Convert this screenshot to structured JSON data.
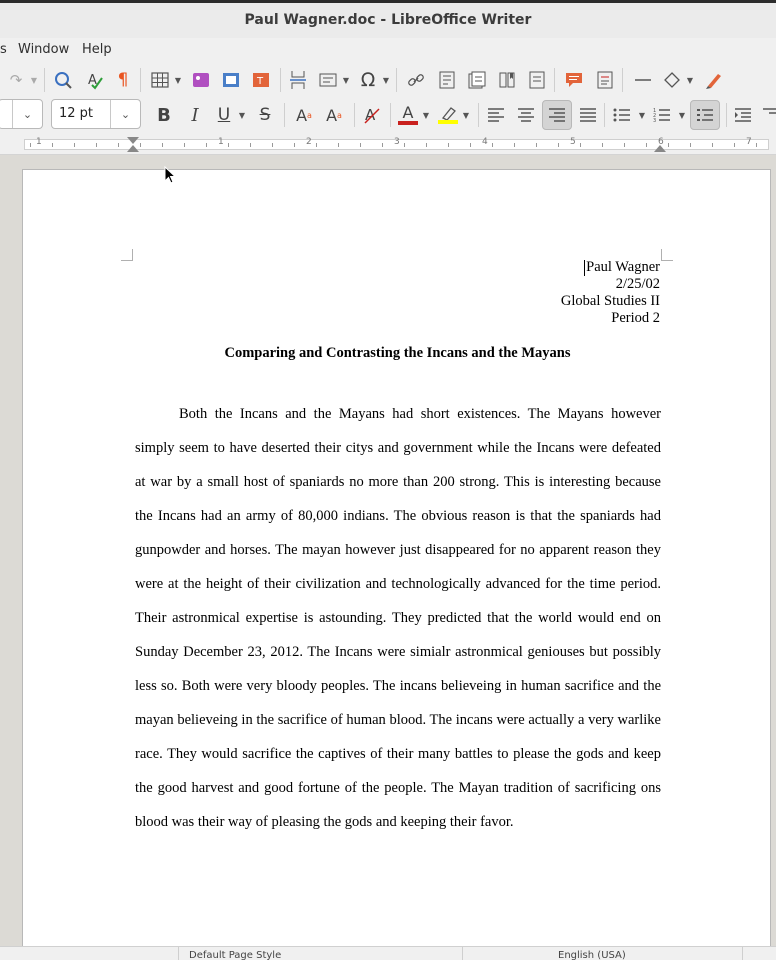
{
  "window": {
    "title": "Paul Wagner.doc - LibreOffice Writer"
  },
  "menu": {
    "items": [
      "s",
      "Window",
      "Help"
    ]
  },
  "format": {
    "font_size": "12 pt"
  },
  "document": {
    "header": [
      "Paul Wagner",
      "2/25/02",
      "Global Studies II",
      "Period 2"
    ],
    "title": "Comparing and Contrasting the Incans and the Mayans",
    "paragraph": "Both the Incans and the Mayans had short existences.  The Mayans however simply seem to have deserted their citys and government while the Incans were defeated at war by a small host of spaniards no more than 200 strong.  This is interesting because the Incans had an army of 80,000 indians.  The obvious reason is that the spaniards had gunpowder and horses.  The mayan however just disappeared for no apparent reason they were at the height of their civilization and technologically advanced for the time period.  Their astronmical expertise is astounding.  They predicted that the world would end on Sunday December 23, 2012.  The Incans were simialr astronmical geniouses but possibly less so.  Both were very bloody peoples.  The incans believeing in human sacrifice and the mayan believeing in the sacrifice of human blood.  The incans were actually a very warlike race.  They would sacrifice the captives of their many battles to please the gods and keep the good harvest and good fortune of the people.  The Mayan tradition of sacrificing ons blood was their way of pleasing the gods and keeping their favor."
  },
  "ruler": {
    "numbers": [
      "1",
      "1",
      "2",
      "3",
      "4",
      "5",
      "6",
      "7"
    ]
  },
  "status": {
    "page_style": "Default Page Style",
    "language": "English (USA)"
  },
  "colors": {
    "font_color": "#c9211e",
    "highlight": "#ffff00",
    "accent": "#e95420"
  }
}
